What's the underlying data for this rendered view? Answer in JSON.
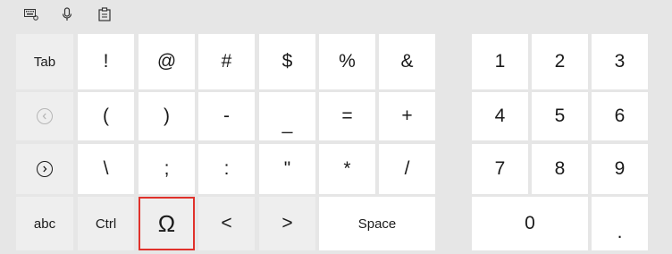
{
  "toolbar": {
    "icons": [
      "keyboard-settings-icon",
      "microphone-icon",
      "clipboard-icon"
    ]
  },
  "keys": {
    "tab": "Tab",
    "exclaim": "!",
    "at": "@",
    "hash": "#",
    "dollar": "$",
    "percent": "%",
    "ampersand": "&",
    "n1": "1",
    "n2": "2",
    "n3": "3",
    "lparen": "(",
    "rparen": ")",
    "minus": "-",
    "underscore": "_",
    "equals": "=",
    "plus": "+",
    "n4": "4",
    "n5": "5",
    "n6": "6",
    "backslash": "\\",
    "semicolon": ";",
    "colon": ":",
    "quote": "\"",
    "asterisk": "*",
    "slash": "/",
    "n7": "7",
    "n8": "8",
    "n9": "9",
    "abc": "abc",
    "ctrl": "Ctrl",
    "omega": "Ω",
    "lt": "<",
    "gt": ">",
    "space": "Space",
    "n0": "0",
    "period": "."
  },
  "colors": {
    "background": "#e6e6e6",
    "key": "#ffffff",
    "key_gray": "#eeeeee",
    "selection": "#e0312b"
  }
}
